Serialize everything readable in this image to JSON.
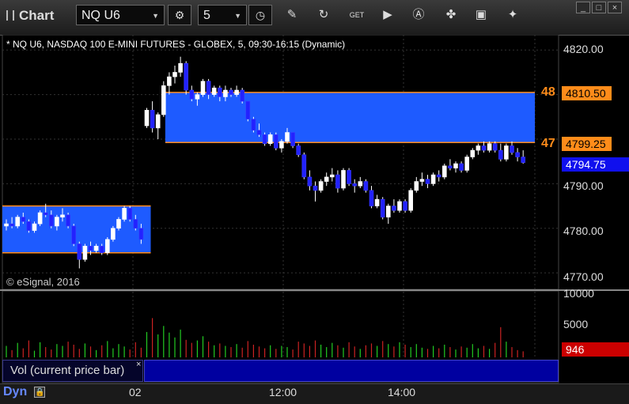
{
  "app": {
    "title": "Chart"
  },
  "toolbar": {
    "symbol": "NQ U6",
    "interval": "5",
    "icons": [
      "gear-icon",
      "clock-icon",
      "pencil-icon",
      "refresh-icon",
      "get-icon",
      "play-icon",
      "alert-icon",
      "tools-icon",
      "comment-icon",
      "twitter-icon"
    ],
    "window_buttons": [
      "minimize",
      "maximize",
      "close"
    ]
  },
  "chart": {
    "description": "* NQ U6, NASDAQ 100 E-MINI FUTURES - GLOBEX, 5, 09:30-16:15 (Dynamic)",
    "copyright": "© eSignal, 2016",
    "price_ticks": [
      "4820.00",
      "4790.00",
      "4780.00",
      "4770.00"
    ],
    "level_48": {
      "label": "48",
      "price": "4810.50"
    },
    "level_47": {
      "label": "47",
      "price": "4799.25"
    },
    "last_price": "4794.75",
    "colors": {
      "box": "#1e5bff",
      "level_line": "#ff8c1a",
      "up": "#ffffff",
      "down": "#2222ff",
      "background": "#000000"
    }
  },
  "volume": {
    "ticks": [
      "10000",
      "5000"
    ],
    "current": "946",
    "study_label": "Vol (current price bar)",
    "study_close": "×"
  },
  "bottom": {
    "mode": "Dyn",
    "times": [
      "02",
      "12:00",
      "14:00"
    ]
  },
  "chart_data": {
    "type": "candlestick",
    "ylim": [
      4767,
      4822
    ],
    "ohlc": [
      [
        4780.5,
        4782.0,
        4779.5,
        4781.0
      ],
      [
        4781.0,
        4782.5,
        4780.0,
        4780.5
      ],
      [
        4780.5,
        4783.0,
        4780.0,
        4782.5
      ],
      [
        4782.5,
        4783.5,
        4781.0,
        4781.5
      ],
      [
        4781.5,
        4782.0,
        4779.0,
        4779.5
      ],
      [
        4779.5,
        4781.5,
        4779.0,
        4781.0
      ],
      [
        4781.0,
        4784.0,
        4780.5,
        4783.5
      ],
      [
        4783.5,
        4785.5,
        4782.5,
        4783.0
      ],
      [
        4783.0,
        4784.0,
        4780.0,
        4780.5
      ],
      [
        4780.5,
        4783.0,
        4779.5,
        4782.5
      ],
      [
        4782.5,
        4784.5,
        4781.5,
        4783.0
      ],
      [
        4783.0,
        4783.5,
        4780.0,
        4780.5
      ],
      [
        4780.5,
        4781.0,
        4776.0,
        4776.5
      ],
      [
        4776.5,
        4777.0,
        4771.0,
        4773.0
      ],
      [
        4773.0,
        4776.5,
        4772.5,
        4776.0
      ],
      [
        4776.0,
        4777.0,
        4774.0,
        4775.0
      ],
      [
        4775.0,
        4776.5,
        4774.5,
        4776.0
      ],
      [
        4776.0,
        4776.5,
        4774.0,
        4774.5
      ],
      [
        4774.5,
        4778.0,
        4774.0,
        4777.5
      ],
      [
        4777.5,
        4780.5,
        4777.0,
        4780.0
      ],
      [
        4780.0,
        4782.5,
        4779.5,
        4782.0
      ],
      [
        4782.0,
        4785.0,
        4781.5,
        4784.5
      ],
      [
        4784.5,
        4785.0,
        4781.5,
        4782.0
      ],
      [
        4782.0,
        4783.0,
        4779.5,
        4780.0
      ],
      [
        4780.0,
        4781.0,
        4776.5,
        4777.5
      ],
      [
        4803.0,
        4807.0,
        4802.5,
        4806.5
      ],
      [
        4806.5,
        4808.5,
        4801.5,
        4802.5
      ],
      [
        4802.5,
        4806.0,
        4800.0,
        4805.5
      ],
      [
        4805.5,
        4813.0,
        4805.0,
        4812.0
      ],
      [
        4812.0,
        4815.0,
        4810.0,
        4814.0
      ],
      [
        4814.0,
        4816.5,
        4812.5,
        4815.0
      ],
      [
        4815.0,
        4818.5,
        4814.0,
        4817.0
      ],
      [
        4817.0,
        4817.5,
        4810.0,
        4811.0
      ],
      [
        4811.0,
        4812.0,
        4808.5,
        4809.0
      ],
      [
        4809.0,
        4810.5,
        4807.5,
        4810.0
      ],
      [
        4810.0,
        4813.5,
        4809.5,
        4813.0
      ],
      [
        4813.0,
        4813.5,
        4809.0,
        4810.0
      ],
      [
        4810.0,
        4812.0,
        4809.5,
        4811.5
      ],
      [
        4811.5,
        4812.0,
        4808.5,
        4809.5
      ],
      [
        4809.5,
        4812.0,
        4808.5,
        4811.0
      ],
      [
        4811.0,
        4811.5,
        4809.5,
        4810.0
      ],
      [
        4810.0,
        4812.0,
        4809.5,
        4811.0
      ],
      [
        4811.0,
        4811.5,
        4808.0,
        4808.5
      ],
      [
        4808.5,
        4808.5,
        4804.0,
        4804.5
      ],
      [
        4804.5,
        4805.0,
        4801.5,
        4802.0
      ],
      [
        4802.0,
        4803.5,
        4800.5,
        4801.0
      ],
      [
        4801.0,
        4801.5,
        4798.5,
        4799.0
      ],
      [
        4799.0,
        4801.5,
        4798.5,
        4801.0
      ],
      [
        4801.0,
        4801.5,
        4797.5,
        4798.0
      ],
      [
        4798.0,
        4800.0,
        4797.0,
        4799.5
      ],
      [
        4799.5,
        4802.5,
        4799.0,
        4801.5
      ],
      [
        4801.5,
        4801.5,
        4798.0,
        4798.5
      ],
      [
        4798.5,
        4799.0,
        4796.0,
        4796.5
      ],
      [
        4796.5,
        4797.0,
        4791.0,
        4791.5
      ],
      [
        4791.5,
        4793.0,
        4788.5,
        4789.5
      ],
      [
        4789.5,
        4790.5,
        4786.0,
        4788.5
      ],
      [
        4788.5,
        4791.0,
        4788.0,
        4790.5
      ],
      [
        4790.5,
        4792.5,
        4789.5,
        4791.5
      ],
      [
        4791.5,
        4793.5,
        4790.5,
        4792.0
      ],
      [
        4792.0,
        4793.0,
        4788.0,
        4789.0
      ],
      [
        4789.0,
        4793.5,
        4788.5,
        4793.0
      ],
      [
        4793.0,
        4793.5,
        4789.5,
        4790.0
      ],
      [
        4790.0,
        4791.0,
        4788.0,
        4789.5
      ],
      [
        4789.5,
        4791.5,
        4789.0,
        4790.5
      ],
      [
        4790.5,
        4791.0,
        4788.0,
        4788.5
      ],
      [
        4788.5,
        4789.5,
        4784.5,
        4785.0
      ],
      [
        4785.0,
        4787.5,
        4784.5,
        4786.5
      ],
      [
        4786.5,
        4787.0,
        4782.0,
        4782.5
      ],
      [
        4782.5,
        4785.5,
        4781.0,
        4785.0
      ],
      [
        4785.0,
        4786.5,
        4783.5,
        4784.0
      ],
      [
        4784.0,
        4786.5,
        4783.5,
        4786.0
      ],
      [
        4786.0,
        4786.5,
        4783.5,
        4784.0
      ],
      [
        4784.0,
        4789.0,
        4783.5,
        4788.5
      ],
      [
        4788.5,
        4791.5,
        4788.0,
        4790.5
      ],
      [
        4790.5,
        4792.5,
        4789.5,
        4791.0
      ],
      [
        4791.0,
        4792.0,
        4789.0,
        4790.0
      ],
      [
        4790.0,
        4792.5,
        4789.5,
        4792.0
      ],
      [
        4792.0,
        4793.0,
        4790.5,
        4791.5
      ],
      [
        4791.5,
        4794.5,
        4791.0,
        4794.0
      ],
      [
        4794.0,
        4795.5,
        4793.0,
        4793.5
      ],
      [
        4793.5,
        4795.0,
        4792.5,
        4794.5
      ],
      [
        4794.5,
        4795.0,
        4792.5,
        4793.0
      ],
      [
        4793.0,
        4796.5,
        4792.5,
        4796.0
      ],
      [
        4796.0,
        4798.0,
        4795.5,
        4797.5
      ],
      [
        4797.5,
        4799.0,
        4796.5,
        4798.5
      ],
      [
        4798.5,
        4799.5,
        4797.0,
        4797.5
      ],
      [
        4797.5,
        4799.5,
        4797.0,
        4799.0
      ],
      [
        4799.0,
        4799.5,
        4797.0,
        4797.5
      ],
      [
        4797.5,
        4799.0,
        4795.0,
        4795.5
      ],
      [
        4795.5,
        4799.0,
        4795.0,
        4798.5
      ],
      [
        4798.5,
        4799.5,
        4796.5,
        4797.0
      ],
      [
        4797.0,
        4798.0,
        4795.0,
        4796.0
      ],
      [
        4796.0,
        4797.5,
        4794.5,
        4794.75
      ]
    ],
    "volume": [
      1900,
      1200,
      2400,
      1500,
      2800,
      1100,
      2500,
      1700,
      1300,
      2200,
      1900,
      2600,
      2100,
      1400,
      2300,
      1800,
      1200,
      2000,
      2700,
      1500,
      2200,
      1800,
      1300,
      2500,
      1600,
      4200,
      6500,
      3800,
      5200,
      4100,
      3300,
      4600,
      2900,
      2400,
      2800,
      3500,
      2600,
      2000,
      2300,
      1900,
      1700,
      2200,
      1600,
      2700,
      2100,
      1800,
      1500,
      2000,
      1400,
      1900,
      1700,
      1300,
      2600,
      2300,
      1900,
      2800,
      2100,
      1700,
      2400,
      2000,
      1600,
      2500,
      1800,
      1400,
      2000,
      2300,
      1900,
      2700,
      2200,
      1800,
      2500,
      2100,
      1700,
      2200,
      1600,
      1400,
      1900,
      1500,
      2100,
      1700,
      1300,
      1800,
      1600,
      2200,
      1500,
      1900,
      1400,
      2400,
      5000,
      2600,
      1700,
      1200,
      1000
    ],
    "boxes": [
      {
        "from_bar": 0,
        "to_bar": 25,
        "top": 4785.0,
        "bottom": 4774.5
      },
      {
        "from_bar": 29,
        "to_bar": 108,
        "top": 4810.5,
        "bottom": 4799.25
      }
    ]
  }
}
